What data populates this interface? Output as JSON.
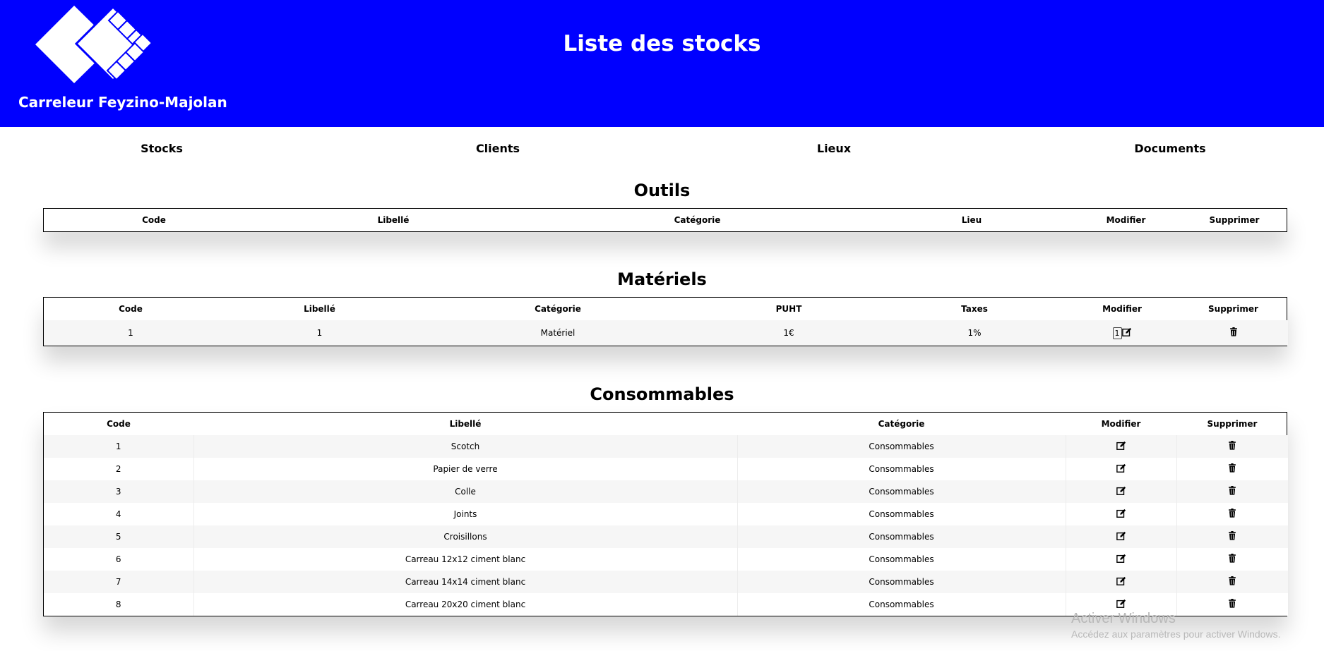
{
  "header": {
    "brand": "Carreleur Feyzino-Majolan",
    "title": "Liste des stocks",
    "bg_color": "#0000ff"
  },
  "nav": [
    {
      "label": "Stocks"
    },
    {
      "label": "Clients"
    },
    {
      "label": "Lieux"
    },
    {
      "label": "Documents"
    }
  ],
  "outils": {
    "title": "Outils",
    "headers": [
      "Code",
      "Libellé",
      "Catégorie",
      "Lieu",
      "Modifier",
      "Supprimer"
    ],
    "rows": []
  },
  "materiels": {
    "title": "Matériels",
    "headers": [
      "Code",
      "Libellé",
      "Catégorie",
      "PUHT",
      "Taxes",
      "Modifier",
      "Supprimer"
    ],
    "rows": [
      {
        "code": "1",
        "libelle": "1",
        "categorie": "Matériel",
        "puht": "1€",
        "taxes": "1%",
        "quantite": "1"
      }
    ]
  },
  "consommables": {
    "title": "Consommables",
    "headers": [
      "Code",
      "Libellé",
      "Catégorie",
      "Modifier",
      "Supprimer"
    ],
    "rows": [
      {
        "code": "1",
        "libelle": "Scotch",
        "categorie": "Consommables"
      },
      {
        "code": "2",
        "libelle": "Papier de verre",
        "categorie": "Consommables"
      },
      {
        "code": "3",
        "libelle": "Colle",
        "categorie": "Consommables"
      },
      {
        "code": "4",
        "libelle": "Joints",
        "categorie": "Consommables"
      },
      {
        "code": "5",
        "libelle": "Croisillons",
        "categorie": "Consommables"
      },
      {
        "code": "6",
        "libelle": "Carreau 12x12 ciment blanc",
        "categorie": "Consommables"
      },
      {
        "code": "7",
        "libelle": "Carreau 14x14 ciment blanc",
        "categorie": "Consommables"
      },
      {
        "code": "8",
        "libelle": "Carreau 20x20 ciment blanc",
        "categorie": "Consommables"
      }
    ]
  },
  "icons": {
    "edit": "edit-icon",
    "delete": "trash-icon"
  },
  "watermark": {
    "line1": "Activer Windows",
    "line2": "Accédez aux paramètres pour activer Windows."
  }
}
